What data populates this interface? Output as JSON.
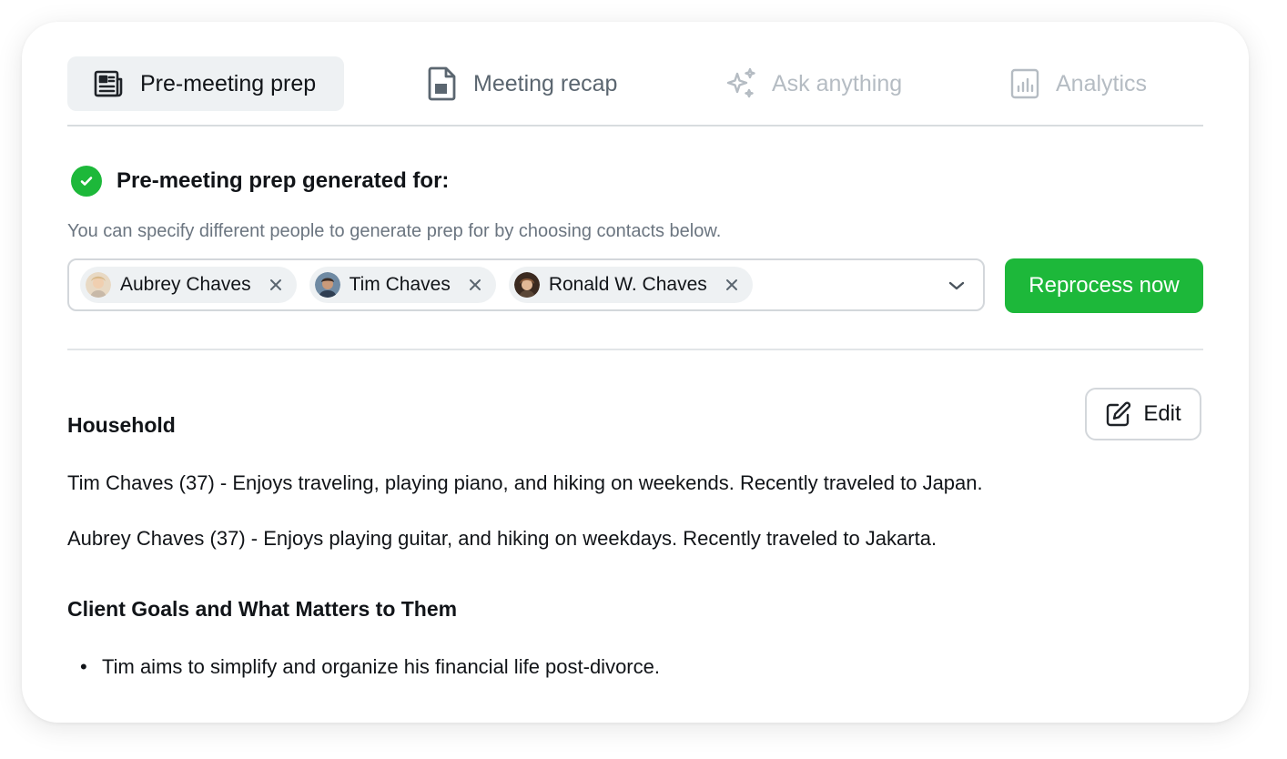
{
  "tabs": [
    {
      "label": "Pre-meeting prep",
      "icon": "newspaper-icon",
      "state": "active"
    },
    {
      "label": "Meeting recap",
      "icon": "document-icon",
      "state": "enabled"
    },
    {
      "label": "Ask anything",
      "icon": "sparkles-icon",
      "state": "disabled"
    },
    {
      "label": "Analytics",
      "icon": "bar-chart-icon",
      "state": "disabled"
    }
  ],
  "status": {
    "title": "Pre-meeting prep generated for:",
    "hint": "You can specify different people to generate prep for by choosing contacts below.",
    "icon": "check-circle-icon",
    "color": "#1db83a"
  },
  "contacts": [
    {
      "name": "Aubrey Chaves",
      "avatar": "avatar-aubrey"
    },
    {
      "name": "Tim Chaves",
      "avatar": "avatar-tim"
    },
    {
      "name": "Ronald W. Chaves",
      "avatar": "avatar-ronald"
    }
  ],
  "actions": {
    "reprocess_label": "Reprocess now",
    "edit_label": "Edit"
  },
  "household": {
    "heading": "Household",
    "lines": [
      "Tim Chaves (37) - Enjoys traveling, playing piano, and hiking on weekends. Recently traveled to Japan.",
      "Aubrey Chaves (37) - Enjoys playing guitar, and hiking on weekdays. Recently traveled to Jakarta."
    ]
  },
  "goals": {
    "heading": "Client Goals and What Matters to Them",
    "items": [
      "Tim aims to simplify and organize his financial life post-divorce."
    ]
  },
  "colors": {
    "accent": "#1db83a",
    "tab_active_bg": "#eef1f3",
    "muted_text": "#6b7580",
    "disabled_text": "#b5bcc3"
  }
}
